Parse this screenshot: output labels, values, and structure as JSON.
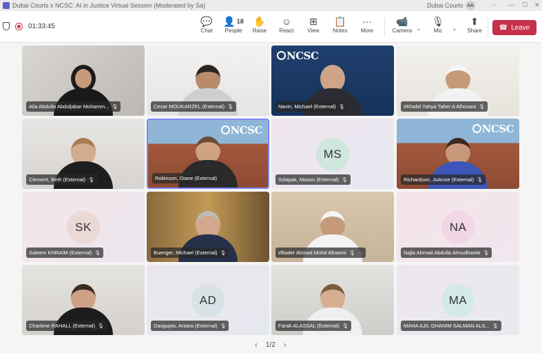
{
  "window": {
    "title": "Dubai Courts x NCSC: AI in Justice Virtual Session (Moderated by Sa)",
    "org": "Dubai Courts",
    "avatar": "AA"
  },
  "toolbar": {
    "timer": "01:33:45",
    "buttons": [
      {
        "label": "Chat",
        "icon": "chat-icon"
      },
      {
        "label": "People",
        "icon": "people-icon",
        "count": "18"
      },
      {
        "label": "Raise",
        "icon": "hand-icon"
      },
      {
        "label": "React",
        "icon": "smile-icon"
      },
      {
        "label": "View",
        "icon": "grid-icon"
      },
      {
        "label": "Notes",
        "icon": "notes-icon"
      },
      {
        "label": "More",
        "icon": "more-icon"
      },
      {
        "label": "Camera",
        "icon": "camera-icon"
      },
      {
        "label": "Mic",
        "icon": "mic-off-icon"
      },
      {
        "label": "Share",
        "icon": "share-icon"
      }
    ],
    "leave_label": "Leave"
  },
  "tiles": [
    {
      "name": "Alia Abdulla Abduljabar Mohamm...",
      "initials": ""
    },
    {
      "name": "Cesar MOUKARZEL (External)",
      "initials": ""
    },
    {
      "name": "Navin, Michael (External)",
      "initials": ""
    },
    {
      "name": "I/Khalid Yahya Taher A Alhosani",
      "initials": ""
    },
    {
      "name": "Clement, Beth (External)",
      "initials": ""
    },
    {
      "name": "Robinson, Diane (External)",
      "initials": ""
    },
    {
      "name": "Szlapak, Mason (External)",
      "initials": "MS"
    },
    {
      "name": "Richardson, JoAnne (External)",
      "initials": ""
    },
    {
      "name": "Saleem KHRAIM (External)",
      "initials": "SK"
    },
    {
      "name": "Buenger, Michael (External)",
      "initials": ""
    },
    {
      "name": "I/Bader Ahmad Mohd Alhasmi",
      "initials": ""
    },
    {
      "name": "Najla Ahmad Abdulla Almudhareb",
      "initials": "NA"
    },
    {
      "name": "Charlene RAHALL (External)",
      "initials": ""
    },
    {
      "name": "Dasgupta, Antara (External)",
      "initials": "AD"
    },
    {
      "name": "Farah ALASSAL (External)",
      "initials": ""
    },
    {
      "name": "MAHA AJIL GHANIM SALMAN ALS...",
      "initials": "MA"
    }
  ],
  "logo_text": "NCSC",
  "pager": {
    "label": "1/2"
  }
}
